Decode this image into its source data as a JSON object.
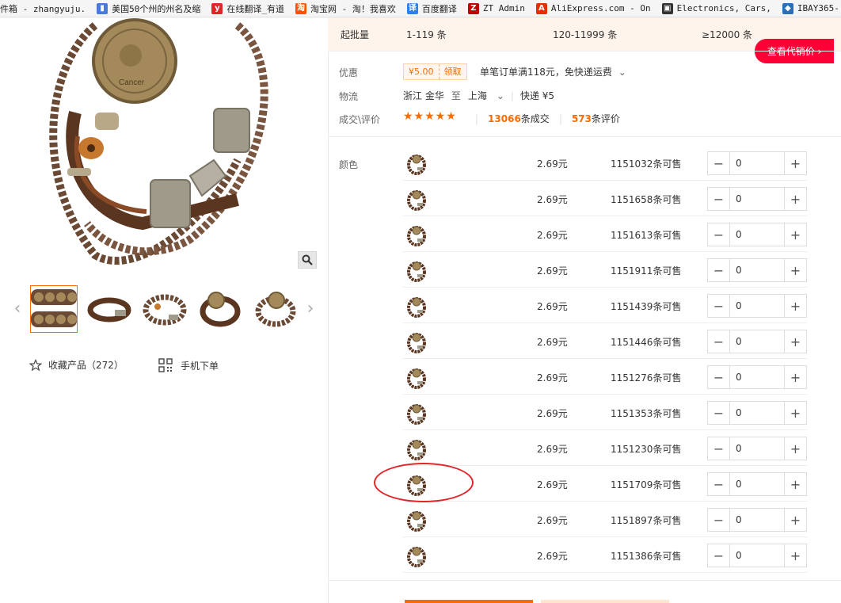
{
  "bookmarks": [
    {
      "label": "件箱 - zhangyuju.",
      "icon": "mail-icon",
      "color": "#ffffff"
    },
    {
      "label": "美国50个州的州名及缩",
      "icon": "bookmark-doc-icon",
      "color": "#4a7ad8"
    },
    {
      "label": "在线翻译_有道",
      "icon": "youdao-icon",
      "color": "#e0262a"
    },
    {
      "label": "淘宝网 - 淘！我喜欢",
      "icon": "taobao-icon",
      "color": "#ff5000"
    },
    {
      "label": "百度翻译",
      "icon": "baidu-translate-icon",
      "color": "#2f7ef6"
    },
    {
      "label": "ZT Admin",
      "icon": "zt-admin-icon",
      "color": "#c00000"
    },
    {
      "label": "AliExpress.com - On",
      "icon": "aliexpress-icon",
      "color": "#e62e04"
    },
    {
      "label": "Electronics, Cars, ",
      "icon": "ebay-bag-icon",
      "color": "#333333"
    },
    {
      "label": "IBAY365-",
      "icon": "ibay-icon",
      "color": "#2d6db5"
    }
  ],
  "gallery": {
    "thumbnails_count": 5,
    "active_thumb_index": 0
  },
  "actions": {
    "favorite_label": "收藏产品（272）",
    "mobile_order_label": "手机下单"
  },
  "moq": {
    "label": "起批量",
    "tiers": [
      "1-119 条",
      "120-11999 条",
      "≥12000 条"
    ]
  },
  "proxy_button": "查看代销价 ›",
  "promo": {
    "label": "优惠",
    "coupon_amount": "¥5.00",
    "coupon_get": "领取",
    "text": "单笔订单满118元，免快递运费"
  },
  "logistics": {
    "label": "物流",
    "from": "浙江 金华",
    "to_word": "至",
    "to": "上海",
    "shipping": "快递 ¥5"
  },
  "reviews": {
    "label": "成交\\评价",
    "stars": "★★★★★",
    "deals_count": "13066",
    "deals_suffix": "条成交",
    "reviews_count": "573",
    "reviews_suffix": "条评价"
  },
  "sku": {
    "label": "颜色",
    "rows": [
      {
        "price": "2.69元",
        "stock": "1151032条可售",
        "qty": "0"
      },
      {
        "price": "2.69元",
        "stock": "1151658条可售",
        "qty": "0"
      },
      {
        "price": "2.69元",
        "stock": "1151613条可售",
        "qty": "0"
      },
      {
        "price": "2.69元",
        "stock": "1151911条可售",
        "qty": "0"
      },
      {
        "price": "2.69元",
        "stock": "1151439条可售",
        "qty": "0"
      },
      {
        "price": "2.69元",
        "stock": "1151446条可售",
        "qty": "0"
      },
      {
        "price": "2.69元",
        "stock": "1151276条可售",
        "qty": "0"
      },
      {
        "price": "2.69元",
        "stock": "1151353条可售",
        "qty": "0"
      },
      {
        "price": "2.69元",
        "stock": "1151230条可售",
        "qty": "0"
      },
      {
        "price": "2.69元",
        "stock": "1151709条可售",
        "qty": "0"
      },
      {
        "price": "2.69元",
        "stock": "1151897条可售",
        "qty": "0"
      },
      {
        "price": "2.69元",
        "stock": "1151386条可售",
        "qty": "0"
      }
    ],
    "minus_symbol": "−",
    "plus_symbol": "+"
  },
  "colors": {
    "accent": "#ff6a00",
    "proxy_button": "#ff0036",
    "annotation": "#e0262a"
  }
}
